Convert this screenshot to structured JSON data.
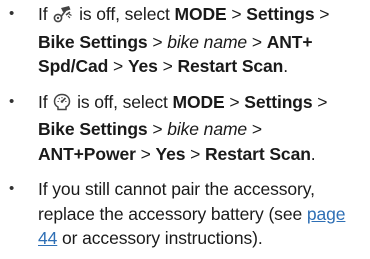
{
  "bullet_char": "•",
  "items": [
    {
      "if": "If",
      "icon": "speed-cadence-sensor-icon",
      "is_off": "is off, select",
      "mode": "MODE",
      "sep1": ">",
      "settings": "Settings",
      "sep2": ">",
      "bike_settings": "Bike Settings",
      "sep3": ">",
      "bike_name": "bike name",
      "sep4": ">",
      "sensor": "ANT+ Spd/Cad",
      "sep5": ">",
      "yes": "Yes",
      "sep6": ">",
      "restart": "Restart Scan",
      "end": "."
    },
    {
      "if": "If",
      "icon": "power-meter-icon",
      "is_off": "is off, select",
      "mode": "MODE",
      "sep1": ">",
      "settings": "Settings",
      "sep2": ">",
      "bike_settings": "Bike Settings",
      "sep3": ">",
      "bike_name": "bike name",
      "sep4": ">",
      "sensor": "ANT+Power",
      "sep5": ">",
      "yes": "Yes",
      "sep6": ">",
      "restart": "Restart Scan",
      "end": "."
    },
    {
      "text_before": "If you still cannot pair the accessory, replace the accessory battery (see",
      "link": "page 44",
      "text_after": "or accessory instructions)."
    }
  ]
}
